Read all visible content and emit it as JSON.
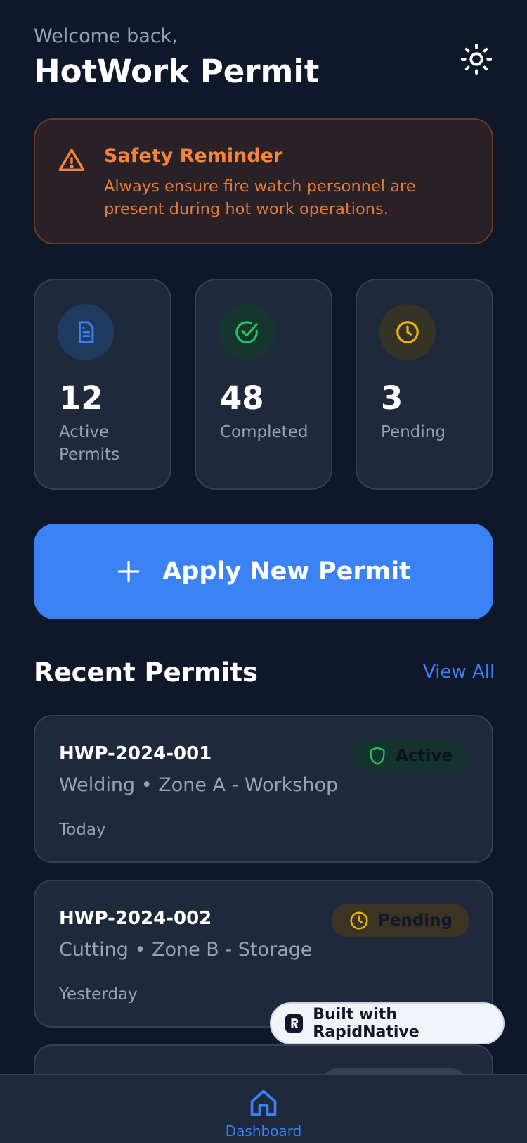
{
  "header": {
    "welcome": "Welcome back,",
    "title": "HotWork Permit",
    "theme_icon": "sun-icon"
  },
  "reminder": {
    "icon": "warning-triangle-icon",
    "title": "Safety Reminder",
    "text": "Always ensure fire watch personnel are present during hot work operations."
  },
  "stats": [
    {
      "icon": "document-icon",
      "value": "12",
      "label": "Active Permits",
      "color": "#3b82f6"
    },
    {
      "icon": "check-circle-icon",
      "value": "48",
      "label": "Completed",
      "color": "#22c55e"
    },
    {
      "icon": "clock-icon",
      "value": "3",
      "label": "Pending",
      "color": "#eab308"
    }
  ],
  "apply_button": {
    "icon": "plus-icon",
    "label": "Apply New Permit"
  },
  "recent": {
    "title": "Recent Permits",
    "view_all": "View All",
    "items": [
      {
        "id": "HWP-2024-001",
        "meta": "Welding • Zone A - Workshop",
        "date": "Today",
        "status": "Active",
        "status_icon": "shield-icon",
        "status_color": "#22c55e"
      },
      {
        "id": "HWP-2024-002",
        "meta": "Cutting • Zone B - Storage",
        "date": "Yesterday",
        "status": "Pending",
        "status_icon": "clock-icon",
        "status_color": "#eab308"
      }
    ]
  },
  "built_with": {
    "label": "Built with RapidNative"
  },
  "tabbar": {
    "items": [
      {
        "icon": "home-icon",
        "label": "Dashboard",
        "active": true
      }
    ]
  },
  "colors": {
    "background": "#0f172a",
    "card": "#1e293b",
    "accent": "#3b82f6",
    "warning": "#f2843b"
  }
}
